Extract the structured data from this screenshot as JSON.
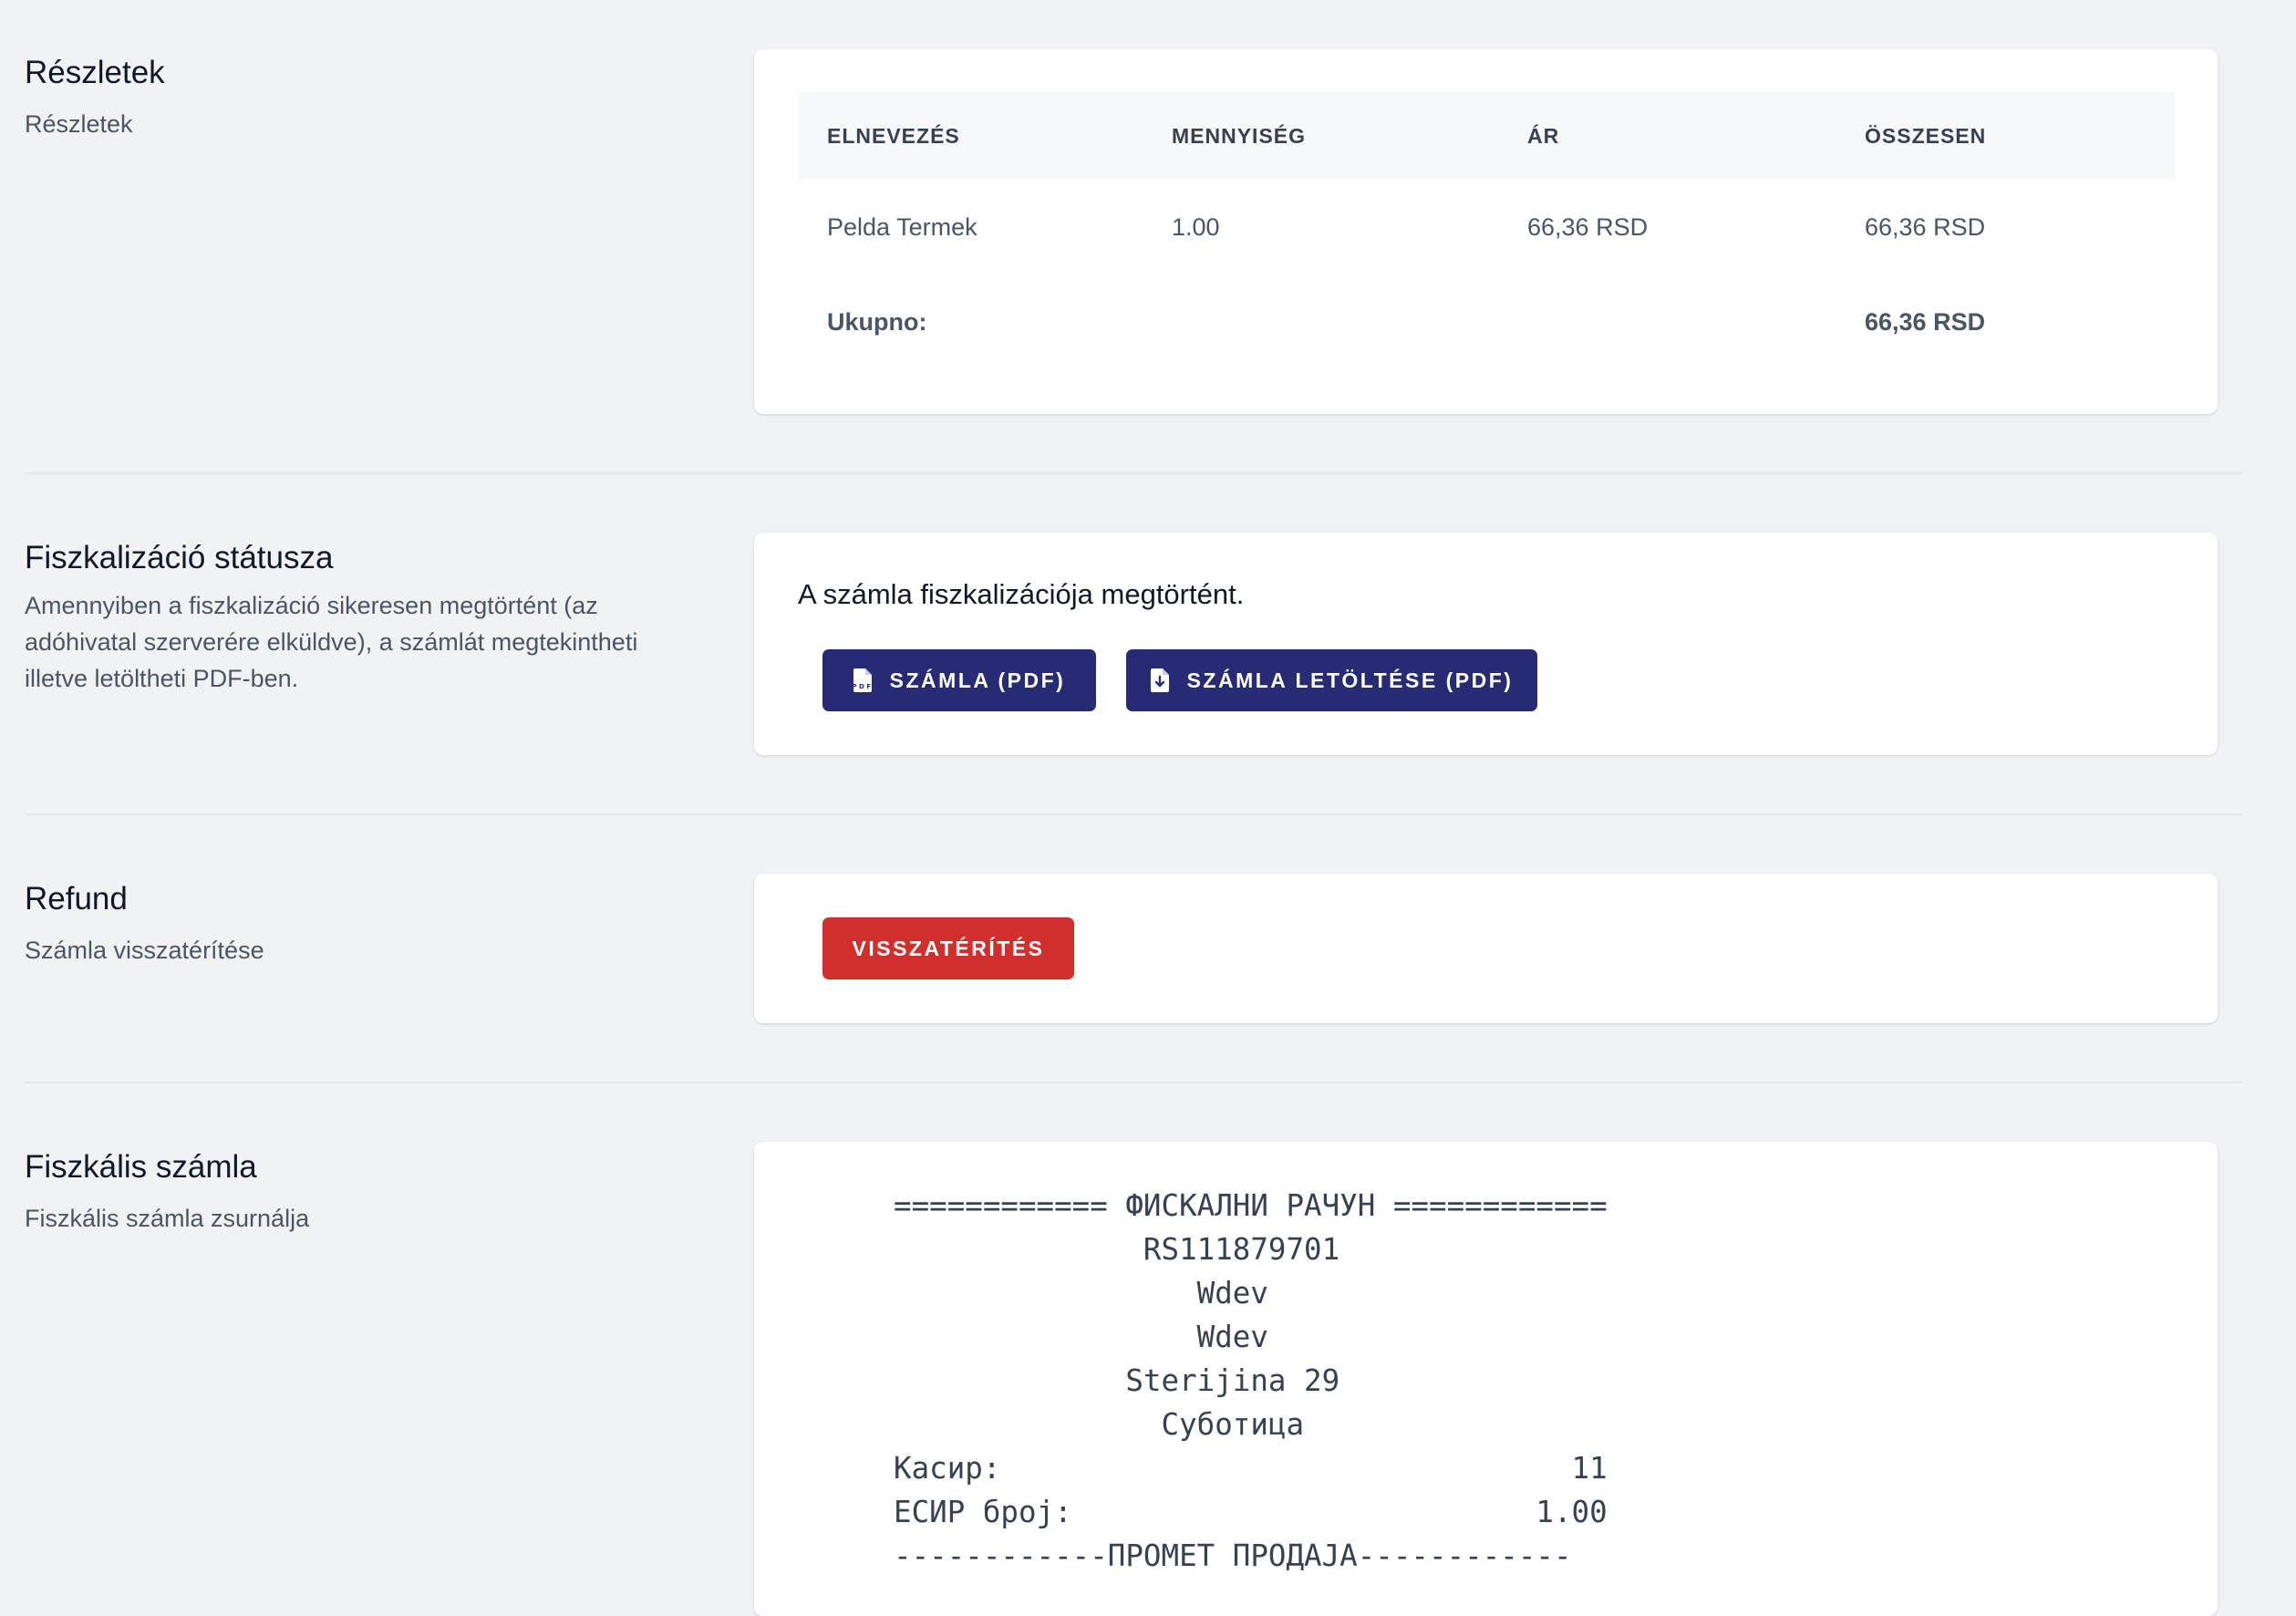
{
  "details": {
    "title": "Részletek",
    "description": "Részletek",
    "table": {
      "headers": [
        "ELNEVEZÉS",
        "MENNYISÉG",
        "ÁR",
        "ÖSSZESEN"
      ],
      "rows": [
        {
          "name": "Pelda Termek",
          "qty": "1.00",
          "price": "66,36 RSD",
          "total": "66,36 RSD"
        }
      ],
      "footer": {
        "label": "Ukupno:",
        "total": "66,36 RSD"
      }
    }
  },
  "fiscalization": {
    "title": "Fiszkalizáció státusza",
    "description": "Amennyiben a fiszkalizáció sikeresen megtörtént (az adóhivatal szerverére elküldve), a számlát megtekintheti illetve letöltheti PDF-ben.",
    "status_text": "A számla fiszkalizációja megtörtént.",
    "view_pdf_label": "SZÁMLA (PDF)",
    "download_pdf_label": "SZÁMLA LETÖLTÉSE (PDF)",
    "colors": {
      "button": "#262b73"
    }
  },
  "refund": {
    "title": "Refund",
    "description": "Számla visszatérítése",
    "button_label": "VISSZATÉRÍTÉS",
    "colors": {
      "button": "#d02f2b"
    }
  },
  "fiscal_receipt": {
    "title": "Fiszkális számla",
    "description": "Fiszkális számla zsurnálja",
    "journal": "============ ФИСКАЛНИ РАЧУН ============\n              RS111879701\n                 Wdev\n                 Wdev\n             Sterijina 29\n               Суботица\nКасир:                                11\nЕСИР број:                          1.00\n------------ПРОМЕТ ПРОДАЈА------------"
  }
}
